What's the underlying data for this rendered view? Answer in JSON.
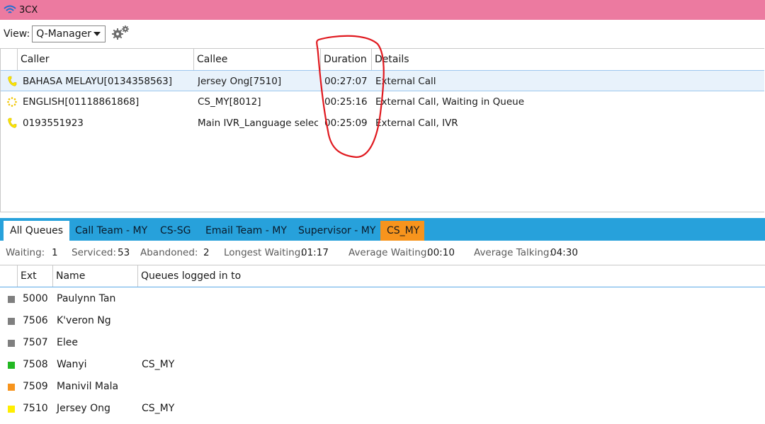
{
  "window": {
    "title": "3CX",
    "titlebar_color": "#ec7aa0"
  },
  "toolbar": {
    "view_label": "View:",
    "view_selected": "Q-Manager",
    "settings_icon": "gears-icon"
  },
  "calls": {
    "columns": [
      "Caller",
      "Callee",
      "Duration",
      "Details"
    ],
    "rows": [
      {
        "status_icon": "phone-icon",
        "caller": "BAHASA MELAYU[0134358563]",
        "callee": "Jersey Ong[7510]",
        "duration": "00:27:07",
        "details": "External Call",
        "selected": true
      },
      {
        "status_icon": "ringing-dots-icon",
        "caller": "ENGLISH[01118861868]",
        "callee": "CS_MY[8012]",
        "duration": "00:25:16",
        "details": "External Call, Waiting in Queue",
        "selected": false
      },
      {
        "status_icon": "phone-icon",
        "caller": "0193551923",
        "callee": "Main IVR_Language selectio",
        "duration": "00:25:09",
        "details": "External Call, IVR",
        "selected": false
      }
    ]
  },
  "queue_tabs": [
    {
      "label": "All Queues",
      "state": "active"
    },
    {
      "label": "Call Team - MY",
      "state": "normal"
    },
    {
      "label": "CS-SG",
      "state": "normal"
    },
    {
      "label": "Email Team - MY",
      "state": "normal"
    },
    {
      "label": "Supervisor - MY",
      "state": "normal"
    },
    {
      "label": "CS_MY",
      "state": "highlighted"
    }
  ],
  "stats": {
    "waiting_label": "Waiting:",
    "waiting": "1",
    "serviced_label": "Serviced:",
    "serviced": "53",
    "abandoned_label": "Abandoned:",
    "abandoned": "2",
    "longest_label": "Longest Waiting:",
    "longest": "01:17",
    "avg_wait_label": "Average Waiting:",
    "avg_wait": "00:10",
    "avg_talk_label": "Average Talking:",
    "avg_talk": "04:30"
  },
  "agents": {
    "columns": [
      "Ext",
      "Name",
      "Queues logged in to"
    ],
    "rows": [
      {
        "status_color": "#7f7f7f",
        "ext": "5000",
        "name": "Paulynn Tan",
        "queues": ""
      },
      {
        "status_color": "#7f7f7f",
        "ext": "7506",
        "name": "K'veron Ng",
        "queues": ""
      },
      {
        "status_color": "#7f7f7f",
        "ext": "7507",
        "name": "Elee",
        "queues": ""
      },
      {
        "status_color": "#22b822",
        "ext": "7508",
        "name": "Wanyi",
        "queues": "CS_MY"
      },
      {
        "status_color": "#f7941d",
        "ext": "7509",
        "name": "Manivil Mala",
        "queues": ""
      },
      {
        "status_color": "#ffee00",
        "ext": "7510",
        "name": "Jersey Ong",
        "queues": "CS_MY"
      }
    ]
  },
  "colors": {
    "tab_bar": "#27a1db",
    "highlight_tab": "#f7941d",
    "annotation": "#e0191f"
  }
}
